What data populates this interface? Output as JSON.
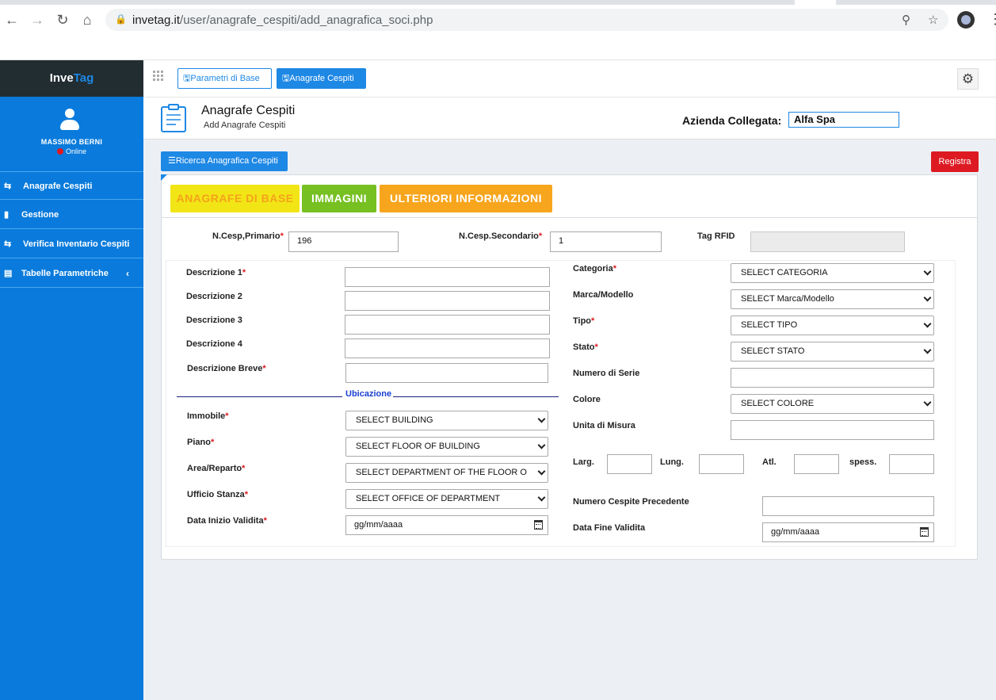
{
  "browser": {
    "url_host": "invetag.it",
    "url_path": "/user/anagrafe_cespiti/add_anagrafica_soci.php"
  },
  "sidebar": {
    "logo_part1": "Inve",
    "logo_part2": "Tag",
    "user_name": "MASSIMO BERNI",
    "user_status": "Online",
    "items": [
      {
        "label": "Anagrafe Cespiti",
        "icon": "exchange-icon"
      },
      {
        "label": "Gestione",
        "icon": "bar-chart-icon"
      },
      {
        "label": "Verifica Inventario Cespiti",
        "icon": "exchange-icon"
      },
      {
        "label": "Tabelle Parametriche",
        "icon": "book-icon"
      }
    ]
  },
  "toolbar": {
    "btn_parametri": "Parametri di Base",
    "btn_anagrafe": "Anagrafe Cespiti"
  },
  "header": {
    "title": "Anagrafe Cespiti",
    "subtitle": "Add Anagrafe Cespiti",
    "azienda_label": "Azienda Collegata:",
    "azienda_value": "Alfa Spa"
  },
  "actions": {
    "ricerca": "Ricerca Anagrafica Cespiti",
    "registra": "Registra"
  },
  "tabs": {
    "base": "ANAGRAFE DI BASE",
    "immagini": "IMMAGINI",
    "info": "ULTERIORI INFORMAZIONI"
  },
  "form": {
    "n_cesp_primario_label": "N.Cesp,Primario",
    "n_cesp_primario_value": "196",
    "n_cesp_secondario_label": "N.Cesp.Secondario",
    "n_cesp_secondario_value": "1",
    "tag_rfid_label": "Tag RFID",
    "descrizione1_label": "Descrizione 1",
    "descrizione2_label": "Descrizione 2",
    "descrizione3_label": "Descrizione 3",
    "descrizione4_label": "Descrizione 4",
    "descrizione_breve_label": "Descrizione Breve",
    "ubicazione_label": "Ubicazione",
    "immobile_label": "Immobile",
    "immobile_value": "SELECT BUILDING",
    "piano_label": "Piano",
    "piano_value": "SELECT FLOOR OF BUILDING",
    "area_label": "Area/Reparto",
    "area_value": "SELECT DEPARTMENT OF THE FLOOR OF BUI",
    "ufficio_label": "Ufficio Stanza",
    "ufficio_value": "SELECT OFFICE OF DEPARTMENT",
    "data_inizio_label": "Data Inizio Validita",
    "date_placeholder": "gg/mm/aaaa",
    "categoria_label": "Categoria",
    "categoria_value": "SELECT CATEGORIA",
    "marca_label": "Marca/Modello",
    "marca_value": "SELECT Marca/Modello",
    "tipo_label": "Tipo",
    "tipo_value": "SELECT TIPO",
    "stato_label": "Stato",
    "stato_value": "SELECT STATO",
    "numero_serie_label": "Numero di Serie",
    "colore_label": "Colore",
    "colore_value": "SELECT COLORE",
    "unita_label": "Unita di Misura",
    "larg_label": "Larg.",
    "lung_label": "Lung.",
    "atl_label": "Atl.",
    "spess_label": "spess.",
    "numero_precedente_label": "Numero Cespite Precedente",
    "data_fine_label": "Data Fine Validita",
    "required_mark": "*"
  },
  "colors": {
    "accent": "#1e88e5",
    "sidebar": "#0a7bdc",
    "danger": "#dd1a22",
    "tab_yellow": "#f2e516",
    "tab_green": "#76c022",
    "tab_orange": "#f7a51d"
  }
}
